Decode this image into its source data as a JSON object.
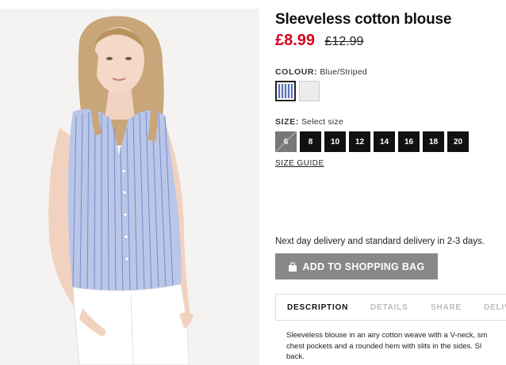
{
  "product": {
    "title": "Sleeveless cotton blouse",
    "price_now": "£8.99",
    "price_old": "£12.99",
    "image_alt": "Model wearing blue striped sleeveless blouse and white shorts"
  },
  "colour": {
    "label": "COLOUR:",
    "value": "Blue/Striped",
    "options": [
      "Blue/Striped",
      "White"
    ]
  },
  "size": {
    "label": "SIZE:",
    "value": "Select size",
    "options": [
      "6",
      "8",
      "10",
      "12",
      "14",
      "16",
      "18",
      "20"
    ],
    "unavailable": [
      "6"
    ],
    "guide_label": "SIZE GUIDE"
  },
  "delivery_text": "Next day delivery and standard delivery in 2-3 days.",
  "add_to_bag_label": "ADD TO SHOPPING BAG",
  "tabs": [
    "DESCRIPTION",
    "DETAILS",
    "SHARE",
    "DELIV"
  ],
  "description_lines": [
    "Sleeveless blouse in an airy cotton weave with a V-neck, sm",
    "chest pockets and a rounded hem with slits in the sides. Sl",
    "back."
  ],
  "colors": {
    "price_red": "#d6001c",
    "button_grey": "#888888",
    "size_black": "#111111"
  }
}
